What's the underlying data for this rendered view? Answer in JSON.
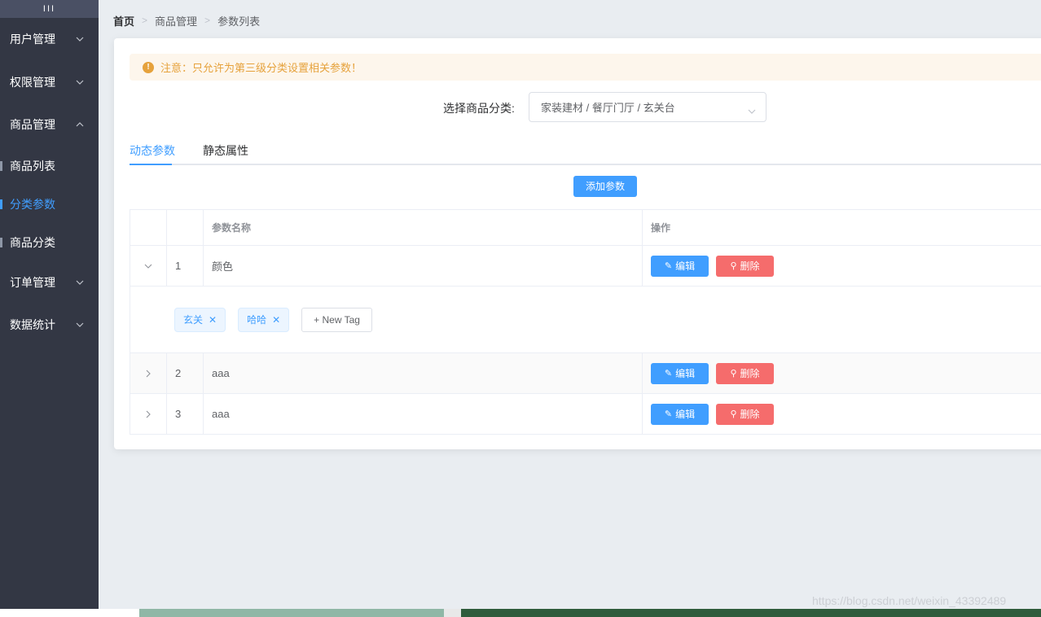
{
  "sidebar": {
    "toggle_label": "III",
    "menu": [
      {
        "label": "用户管理"
      },
      {
        "label": "权限管理"
      },
      {
        "label": "商品管理"
      },
      {
        "label": "订单管理"
      },
      {
        "label": "数据统计"
      }
    ],
    "sub_items": [
      {
        "label": "商品列表"
      },
      {
        "label": "分类参数"
      },
      {
        "label": "商品分类"
      }
    ]
  },
  "breadcrumb": {
    "items": [
      "首页",
      "商品管理",
      "参数列表"
    ]
  },
  "alert": {
    "text": "注意：只允许为第三级分类设置相关参数！"
  },
  "category": {
    "label": "选择商品分类:",
    "value": "家装建材 / 餐厅门厅 / 玄关台"
  },
  "tabs": [
    {
      "label": "动态参数"
    },
    {
      "label": "静态属性"
    }
  ],
  "add_button": "添加参数",
  "table": {
    "headers": [
      "",
      "",
      "参数名称",
      "操作"
    ],
    "rows": [
      {
        "index": "1",
        "name": "颜色"
      },
      {
        "index": "2",
        "name": "aaa"
      },
      {
        "index": "3",
        "name": "aaa"
      }
    ],
    "expanded_tags": [
      "玄关",
      "哈哈"
    ],
    "new_tag_label": "+ New Tag",
    "edit_label": "编辑",
    "delete_label": "删除"
  },
  "watermark": "https://blog.csdn.net/weixin_43392489",
  "colors": {
    "primary": "#409eff",
    "danger": "#f56c6c",
    "warning": "#e6a23c",
    "sidebar": "#333744"
  }
}
